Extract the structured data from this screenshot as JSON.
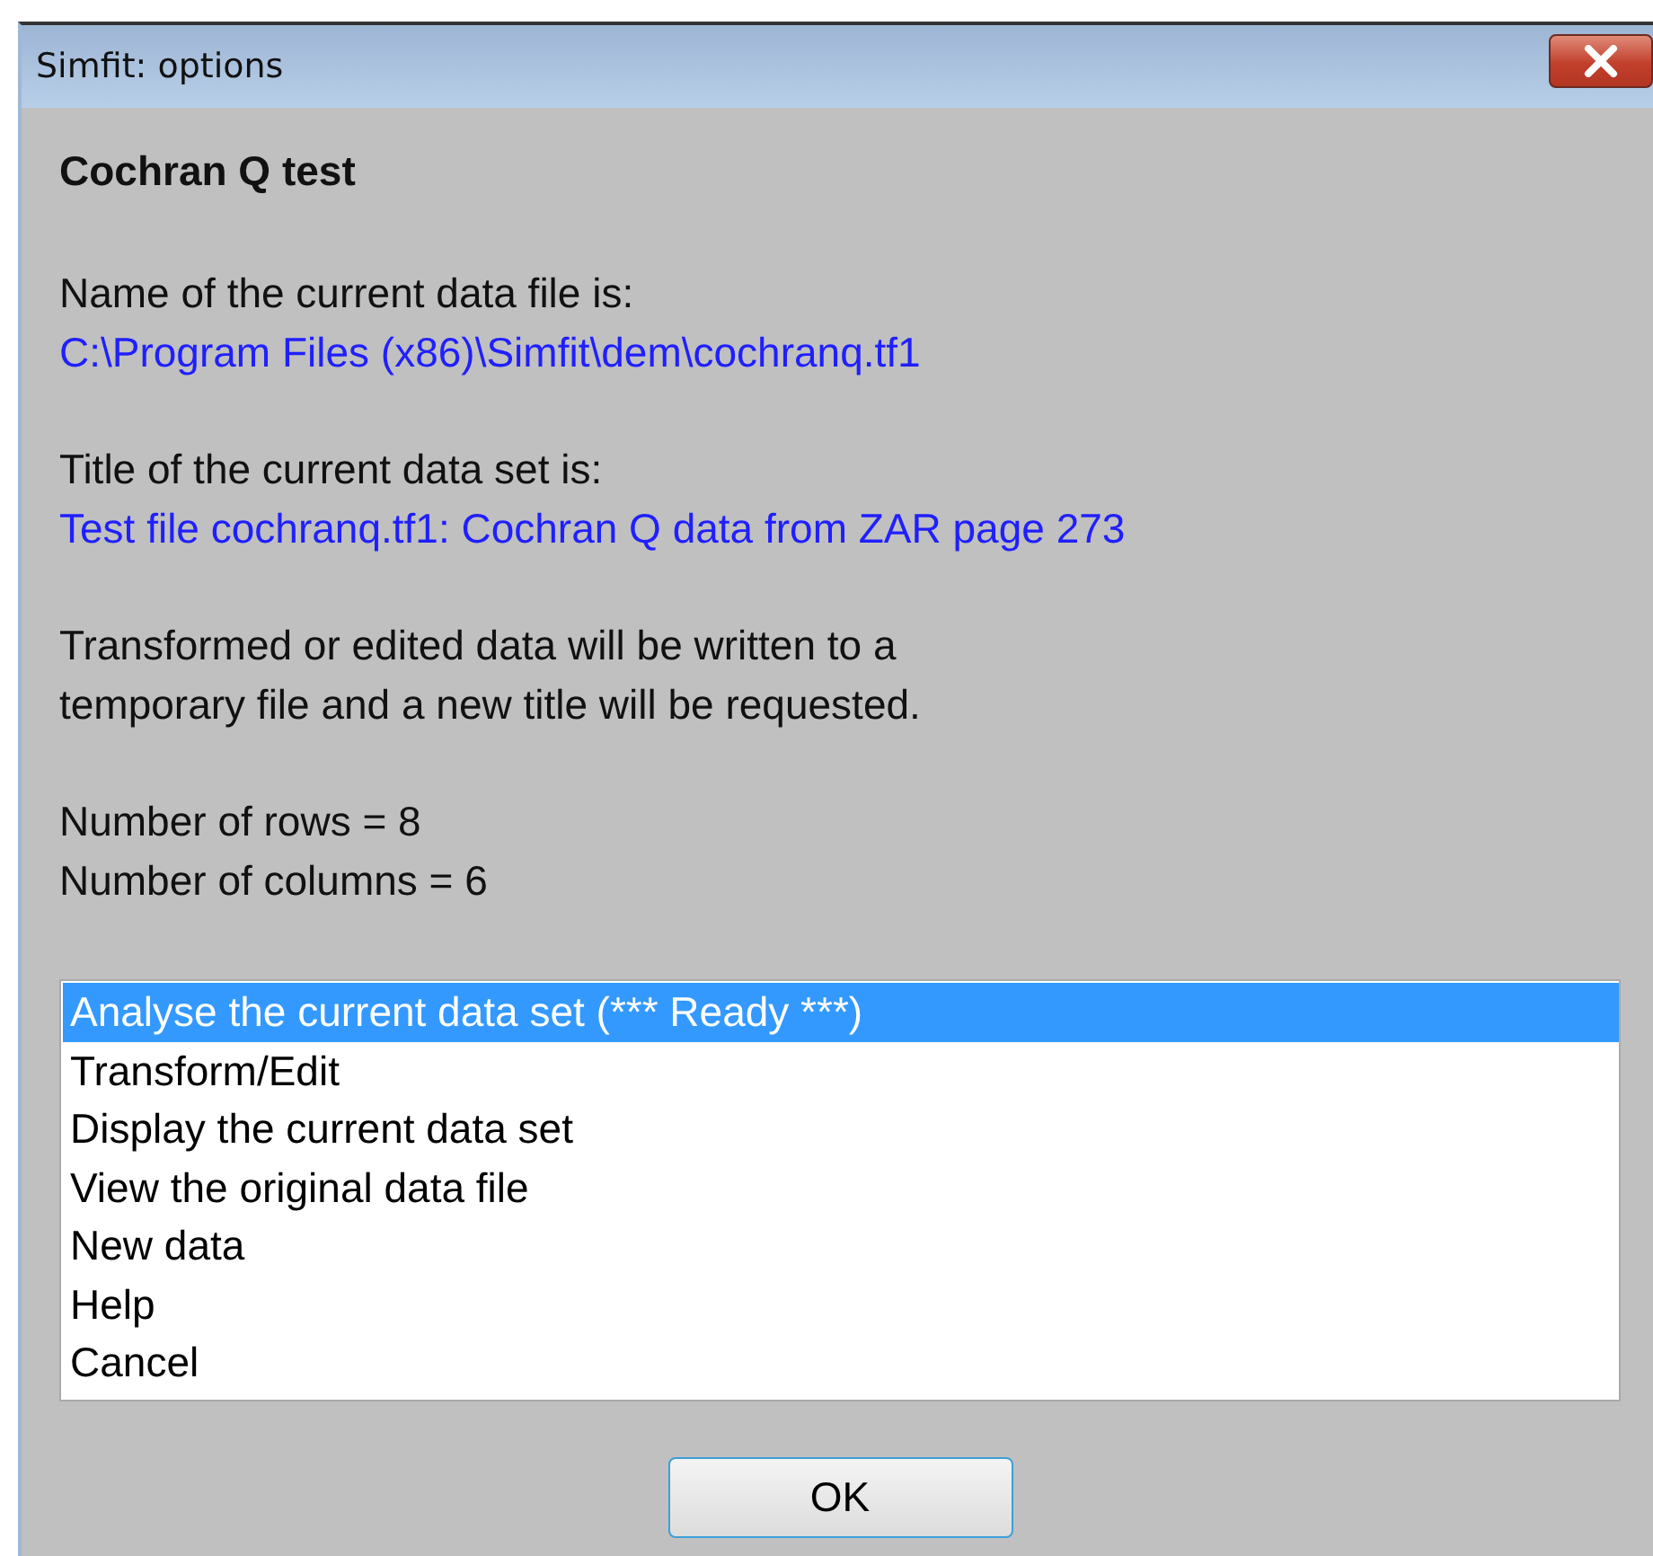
{
  "window": {
    "title": "Simfit: options"
  },
  "heading": "Cochran Q test",
  "sections": [
    {
      "lines": [
        {
          "kind": "label",
          "text": "Name of the current data file is:"
        },
        {
          "kind": "value",
          "text": "C:\\Program Files (x86)\\Simfit\\dem\\cochranq.tf1"
        }
      ]
    },
    {
      "lines": [
        {
          "kind": "label",
          "text": "Title of the current data set is:"
        },
        {
          "kind": "value",
          "text": "Test file cochranq.tf1: Cochran Q data from ZAR page 273"
        }
      ]
    },
    {
      "lines": [
        {
          "kind": "label",
          "text": "Transformed or edited data will be written to a"
        },
        {
          "kind": "label",
          "text": "temporary file and a new title will be requested."
        }
      ]
    },
    {
      "lines": [
        {
          "kind": "label",
          "text": "Number of rows = 8"
        },
        {
          "kind": "label",
          "text": "Number of columns = 6"
        }
      ]
    }
  ],
  "options": [
    {
      "label": "Analyse the current data set (*** Ready ***)",
      "selected": true
    },
    {
      "label": "Transform/Edit",
      "selected": false
    },
    {
      "label": "Display the current data set",
      "selected": false
    },
    {
      "label": "View the original data file",
      "selected": false
    },
    {
      "label": "New data",
      "selected": false
    },
    {
      "label": "Help",
      "selected": false
    },
    {
      "label": "Cancel",
      "selected": false
    }
  ],
  "buttons": [
    "OK"
  ]
}
